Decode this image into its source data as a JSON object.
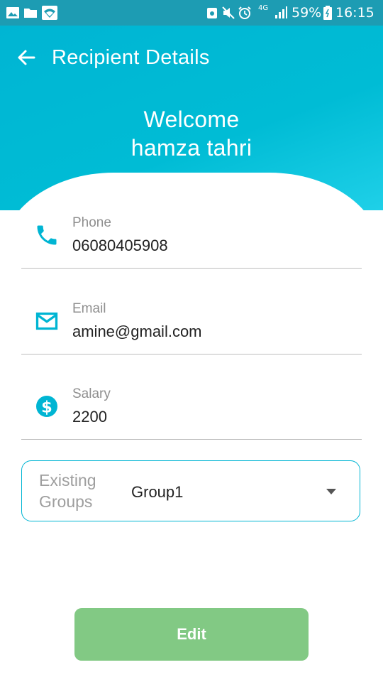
{
  "status_bar": {
    "battery_percent": "59%",
    "time": "16:15",
    "network": "4G",
    "icons": [
      "image-icon",
      "folder-icon",
      "wifi-icon",
      "android-icon",
      "mute-icon",
      "alarm-icon",
      "signal-icon",
      "battery-icon"
    ]
  },
  "app_bar": {
    "title": "Recipient Details",
    "back_icon": "arrow-back-icon"
  },
  "header": {
    "welcome_line": "Welcome",
    "user_name": "hamza tahri"
  },
  "form": {
    "phone": {
      "label": "Phone",
      "value": "06080405908",
      "icon": "phone-icon"
    },
    "email": {
      "label": "Email",
      "value": "amine@gmail.com",
      "icon": "email-icon"
    },
    "salary": {
      "label": "Salary",
      "value": "2200",
      "icon": "dollar-icon"
    },
    "group": {
      "label": "Existing Groups",
      "selected": "Group1",
      "icon": "dropdown-arrow-icon"
    }
  },
  "actions": {
    "edit_label": "Edit"
  },
  "colors": {
    "primary": "#00b5d3",
    "status_bar": "#1d9cb3",
    "button": "#82c984",
    "label": "#8f8f8f",
    "divider": "#bdbdbd"
  }
}
